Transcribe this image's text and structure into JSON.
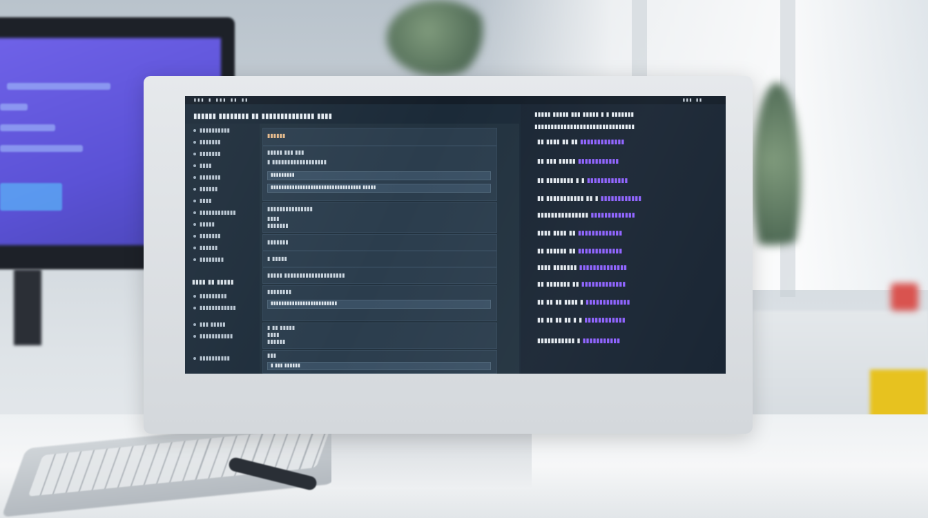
{
  "scene": {
    "description_colors": {
      "accent": "#8e62ff",
      "screen_bg": "#1b2a38",
      "left_screen": "#6f62e8"
    }
  },
  "screen": {
    "topbar_left": "▮▮▮ ▮ ▮▮▮ ▮▮ ▮▮",
    "topbar_right": "▮▮▮ ▮▮",
    "app_title": "▮▮▮▮▮▮ ▮▮▮▮▮▮▮▮ ▮▮ ▮▮▮▮▮▮▮▮▮▮▮▮▮▮ ▮▮▮▮",
    "sidebar": {
      "items": [
        "▮▮▮▮▮▮▮▮▮▮",
        "▮▮▮▮▮▮▮",
        "▮▮▮▮▮▮▮",
        "▮▮▮▮",
        "▮▮▮▮▮▮▮",
        "▮▮▮▮▮▮",
        "▮▮▮▮",
        "▮▮▮▮▮▮▮▮▮▮▮▮",
        "▮▮▮▮▮",
        "▮▮▮▮▮▮▮",
        "▮▮▮▮▮▮",
        "▮▮▮▮▮▮▮▮"
      ],
      "section_head": "▮▮▮▮ ▮▮ ▮▮▮▮▮",
      "items2": [
        "▮▮▮▮▮▮▮▮▮",
        "▮▮▮▮▮▮▮▮▮▮▮▮",
        "▮▮▮ ▮▮▮▮▮",
        "▮▮▮▮▮▮▮▮▮▮▮",
        "▮▮▮▮▮▮▮▮▮▮"
      ]
    },
    "main": {
      "card1_title": "▮▮▮▮▮▮",
      "card1_line1": "▮▮▮▮▮ ▮▮▮ ▮▮▮",
      "card1_line2": "▮ ▮▮▮▮▮▮▮▮▮▮▮▮▮▮▮▮▮▮",
      "input1": "▮▮▮▮▮▮▮▮▮",
      "input2": "▮▮▮▮▮▮▮▮▮▮▮▮▮▮▮▮▮▮▮▮▮▮▮▮▮▮▮▮▮▮▮▮▮▮ ▮▮▮▮▮",
      "card2_title": "▮▮▮▮▮▮▮▮▮▮▮▮▮▮▮",
      "card2_line1": "▮▮▮▮",
      "card2_line2": "▮▮▮▮▮▮▮",
      "card3_line": "▮▮▮▮▮▮▮",
      "card4_line": "▮ ▮▮▮▮▮",
      "card5_line": "▮▮▮▮▮ ▮▮▮▮▮▮▮▮▮▮▮▮▮▮▮▮▮▮▮▮",
      "card6_title": "▮▮▮▮▮▮▮▮",
      "input3": "▮▮▮▮▮▮▮▮▮▮▮▮▮▮▮▮▮▮▮▮▮▮▮▮▮",
      "card7_line1": "▮ ▮▮ ▮▮▮▮▮",
      "card7_line2": "▮▮▮▮",
      "card7_line3": "▮▮▮▮▮▮",
      "card8_line": "▮▮▮",
      "input4": "▮ ▮▮▮ ▮▮▮▮▮▮"
    },
    "rightpane": {
      "head1": "▮▮▮▮▮ ▮▮▮▮▮ ▮▮▮ ▮▮▮▮▮ ▮ ▮ ▮▮▮▮▮▮▮",
      "head2": "▮▮▮▮▮▮▮▮▮▮▮▮▮▮▮▮▮▮▮▮▮▮▮▮▮▮▮▮▮▮▮",
      "rows": [
        {
          "l": "▮▮ ▮▮▮▮ ▮▮ ▮▮",
          "r": "▮▮▮▮▮▮▮▮▮▮▮▮▮"
        },
        {
          "l": "▮▮ ▮▮▮ ▮▮▮▮▮",
          "r": "▮▮▮▮▮▮▮▮▮▮▮▮"
        },
        {
          "l": "▮▮ ▮▮▮▮▮▮▮▮ ▮ ▮",
          "r": "▮▮▮▮▮▮▮▮▮▮▮▮"
        },
        {
          "l": "▮▮ ▮▮▮▮▮▮▮▮▮▮▮ ▮▮ ▮",
          "r": "▮▮▮▮▮▮▮▮▮▮▮▮"
        },
        {
          "l": "▮▮▮▮▮▮▮▮▮▮▮▮▮▮▮",
          "r": "▮▮▮▮▮▮▮▮▮▮▮▮▮"
        },
        {
          "l": "▮▮▮▮ ▮▮▮▮ ▮▮",
          "r": "▮▮▮▮▮▮▮▮▮▮▮▮▮"
        },
        {
          "l": "▮▮ ▮▮▮▮▮▮ ▮▮",
          "r": "▮▮▮▮▮▮▮▮▮▮▮▮▮"
        },
        {
          "l": "▮▮▮▮ ▮▮▮▮▮▮▮",
          "r": "▮▮▮▮▮▮▮▮▮▮▮▮▮▮"
        },
        {
          "l": "▮▮ ▮▮▮▮▮▮▮ ▮▮",
          "r": "▮▮▮▮▮▮▮▮▮▮▮▮▮"
        },
        {
          "l": "▮▮ ▮▮ ▮▮ ▮▮▮▮ ▮",
          "r": "▮▮▮▮▮▮▮▮▮▮▮▮▮"
        },
        {
          "l": "▮▮ ▮▮ ▮▮ ▮▮ ▮ ▮",
          "r": "▮▮▮▮▮▮▮▮▮▮▮▮"
        },
        {
          "l": "▮▮▮▮▮▮▮▮▮▮▮ ▮",
          "r": "▮▮▮▮▮▮▮▮▮▮▮"
        }
      ]
    }
  }
}
